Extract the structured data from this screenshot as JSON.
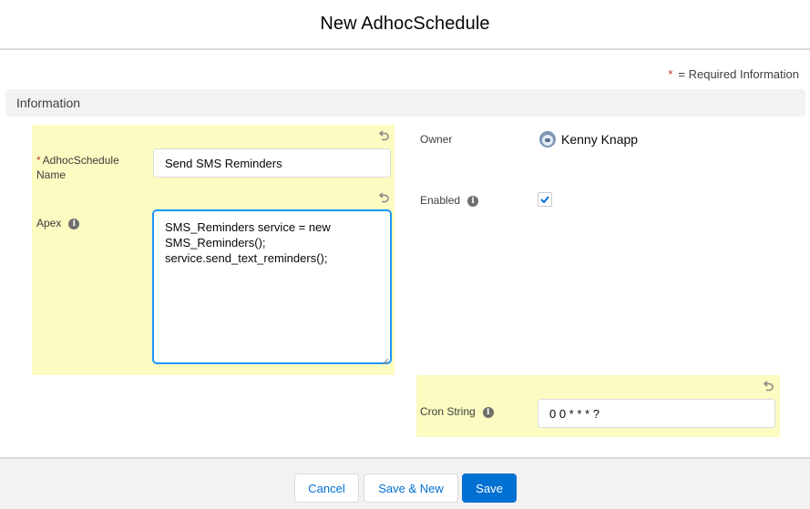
{
  "modal": {
    "title": "New AdhocSchedule"
  },
  "legend": {
    "star": "*",
    "text": "= Required Information"
  },
  "section": {
    "title": "Information"
  },
  "fields": {
    "name": {
      "required_mark": "*",
      "label": "AdhocSchedule Name",
      "value": "Send SMS Reminders"
    },
    "apex": {
      "label": "Apex",
      "value": "SMS_Reminders service = new\nSMS_Reminders();\nservice.send_text_reminders();"
    },
    "owner": {
      "label": "Owner",
      "value": "Kenny Knapp"
    },
    "enabled": {
      "label": "Enabled",
      "checked": true
    },
    "cron": {
      "label": "Cron String",
      "value": "0 0 * * * ?"
    }
  },
  "icons": {
    "info": "info-icon",
    "undo": "undo-icon",
    "avatar": "user-avatar"
  },
  "colors": {
    "highlight": "#fbfbc2",
    "brand": "#0070d2",
    "required": "#c23934"
  },
  "footer": {
    "cancel_label": "Cancel",
    "save_new_label": "Save & New",
    "save_label": "Save"
  }
}
